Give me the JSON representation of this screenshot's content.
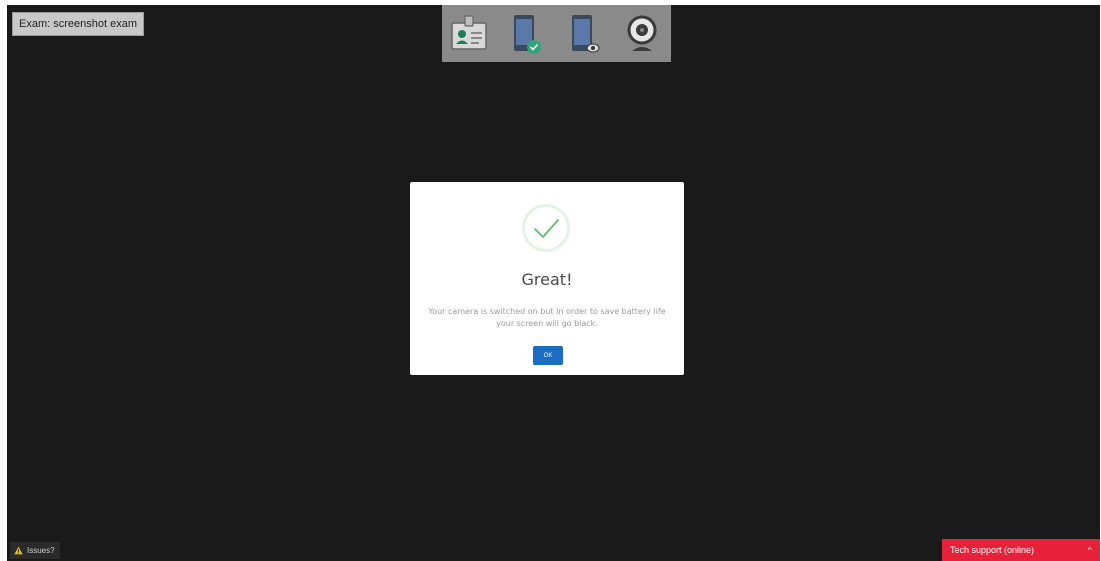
{
  "exam": {
    "label": "Exam: screenshot exam"
  },
  "steps": [
    {
      "icon": "id-card-icon"
    },
    {
      "icon": "phone-check-icon"
    },
    {
      "icon": "phone-eye-icon"
    },
    {
      "icon": "webcam-icon"
    }
  ],
  "modal": {
    "icon": "check-circle-icon",
    "title": "Great!",
    "message": "Your camera is switched on but in order to save battery life your screen will go black.",
    "ok_label": "OK"
  },
  "footer": {
    "issues_label": "Issues?",
    "tech_support_label": "Tech support (online)",
    "caret": "^"
  },
  "colors": {
    "accent_blue": "#1b6dc1",
    "support_red": "#e8213a",
    "success_green": "#5cc06a",
    "badge_teal": "#2fa37a"
  }
}
